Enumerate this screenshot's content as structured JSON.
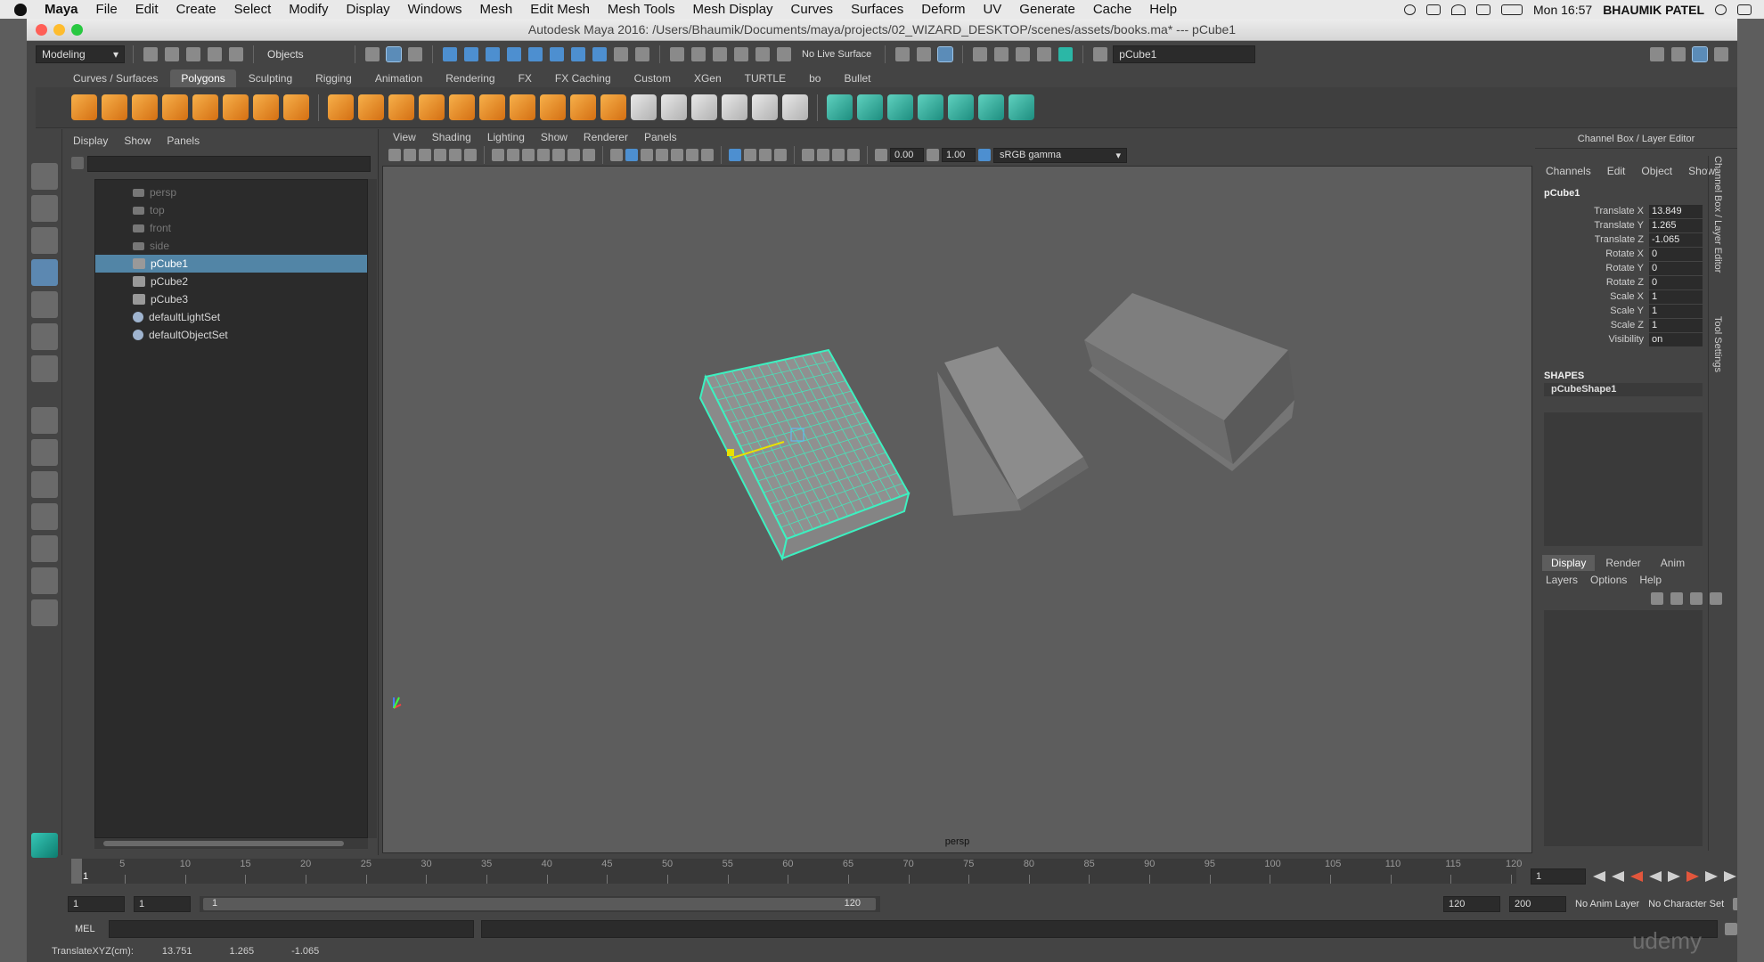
{
  "menubar": {
    "app": "Maya",
    "items": [
      "File",
      "Edit",
      "Create",
      "Select",
      "Modify",
      "Display",
      "Windows",
      "Mesh",
      "Edit Mesh",
      "Mesh Tools",
      "Mesh Display",
      "Curves",
      "Surfaces",
      "Deform",
      "UV",
      "Generate",
      "Cache",
      "Help"
    ],
    "clock": "Mon 16:57",
    "user": "BHAUMIK PATEL"
  },
  "window": {
    "title": "Autodesk Maya 2016: /Users/Bhaumik/Documents/maya/projects/02_WIZARD_DESKTOP/scenes/assets/books.ma*   ---   pCube1"
  },
  "statusline": {
    "menuset": "Modeling",
    "selection_mode": "Objects",
    "live_surface": "No Live Surface",
    "selected_name": "pCube1"
  },
  "shelf": {
    "tabs": [
      "Curves / Surfaces",
      "Polygons",
      "Sculpting",
      "Rigging",
      "Animation",
      "Rendering",
      "FX",
      "FX Caching",
      "Custom",
      "XGen",
      "TURTLE",
      "bo",
      "Bullet"
    ],
    "active_tab": "Polygons"
  },
  "outliner": {
    "menu": [
      "Display",
      "Show",
      "Panels"
    ],
    "items": [
      {
        "label": "persp",
        "hidden": true
      },
      {
        "label": "top",
        "hidden": true
      },
      {
        "label": "front",
        "hidden": true
      },
      {
        "label": "side",
        "hidden": true
      },
      {
        "label": "pCube1",
        "selected": true
      },
      {
        "label": "pCube2"
      },
      {
        "label": "pCube3"
      },
      {
        "label": "defaultLightSet"
      },
      {
        "label": "defaultObjectSet"
      }
    ]
  },
  "viewport": {
    "menu": [
      "View",
      "Shading",
      "Lighting",
      "Show",
      "Renderer",
      "Panels"
    ],
    "exposure": "0.00",
    "gamma": "1.00",
    "color_space": "sRGB gamma",
    "camera": "persp",
    "accent_wire": "#3df0c0"
  },
  "channelbox": {
    "header": "Channel Box / Layer Editor",
    "menu": [
      "Channels",
      "Edit",
      "Object",
      "Show"
    ],
    "object": "pCube1",
    "attributes": [
      {
        "label": "Translate X",
        "value": "13.849"
      },
      {
        "label": "Translate Y",
        "value": "1.265"
      },
      {
        "label": "Translate Z",
        "value": "-1.065"
      },
      {
        "label": "Rotate X",
        "value": "0"
      },
      {
        "label": "Rotate Y",
        "value": "0"
      },
      {
        "label": "Rotate Z",
        "value": "0"
      },
      {
        "label": "Scale X",
        "value": "1"
      },
      {
        "label": "Scale Y",
        "value": "1"
      },
      {
        "label": "Scale Z",
        "value": "1"
      },
      {
        "label": "Visibility",
        "value": "on"
      }
    ],
    "shapes_label": "SHAPES",
    "shape": "pCubeShape1",
    "side_tabs": [
      "Channel Box / Layer Editor",
      "Tool Settings"
    ],
    "layer_tabs": [
      "Display",
      "Render",
      "Anim"
    ],
    "layer_menu": [
      "Layers",
      "Options",
      "Help"
    ]
  },
  "timeslider": {
    "ticks": [
      "1",
      "5",
      "10",
      "15",
      "20",
      "25",
      "30",
      "35",
      "40",
      "45",
      "50",
      "55",
      "60",
      "65",
      "70",
      "75",
      "80",
      "85",
      "90",
      "95",
      "100",
      "105",
      "110",
      "115",
      "120"
    ],
    "current": "1",
    "current_frame_field": "1"
  },
  "range": {
    "start": "1",
    "playback_start": "1",
    "bar_start": "1",
    "bar_end": "120",
    "playback_end": "120",
    "end": "200",
    "anim_layer": "No Anim Layer",
    "character_set": "No Character Set"
  },
  "cmdline": {
    "label": "MEL"
  },
  "helpline": {
    "label": "TranslateXYZ(cm):",
    "x": "13.751",
    "y": "1.265",
    "z": "-1.065"
  },
  "watermark": "udemy"
}
